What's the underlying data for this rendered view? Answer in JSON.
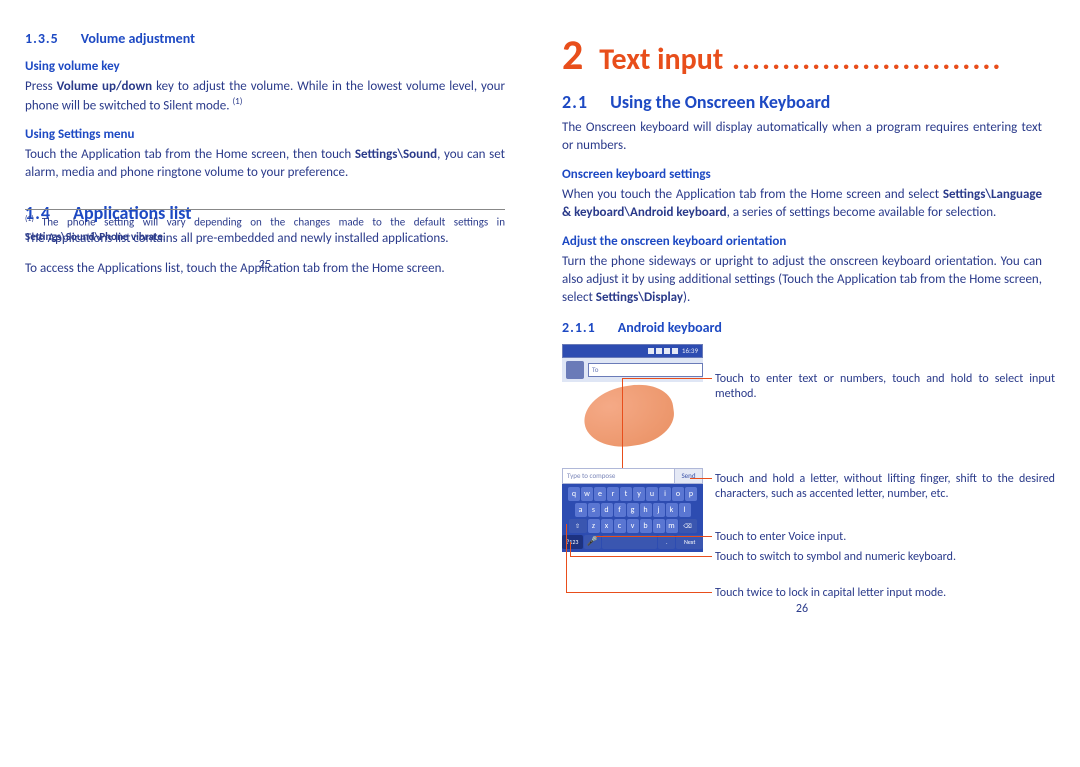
{
  "left": {
    "sec135_num": "1.3.5",
    "sec135_title": "Volume adjustment",
    "using_volume_key": "Using volume key",
    "volume_key_text_a": "Press ",
    "volume_key_bold": "Volume up/down",
    "volume_key_text_b": " key to adjust the volume. While in the lowest volume level, your phone will be switched to Silent mode. ",
    "volume_key_sup": "(1)",
    "using_settings_menu": "Using Settings menu",
    "settings_menu_a": "Touch the Application tab from the Home screen, then touch ",
    "settings_menu_bold": "Settings\\Sound",
    "settings_menu_b": ", you can set alarm, media and phone ringtone volume to your preference.",
    "sec14_num": "1.4",
    "sec14_title": "Applications list",
    "apps_p1": "The Applications list contains all pre-embedded and newly installed applications.",
    "apps_p2": "To access the Applications list, touch the Application tab from the Home screen.",
    "footnote_mark": "(1)",
    "footnote_a": "The phone setting will vary depending on the changes made to the default settings in ",
    "footnote_bold": "Settings\\Sound\\Phone vibrate",
    "footnote_b": ".",
    "page_num": "25"
  },
  "right": {
    "chapter_num": "2",
    "chapter_title": "Text input",
    "chapter_dots": " ...........................",
    "sec21_num": "2.1",
    "sec21_title": "Using the Onscreen Keyboard",
    "intro": "The Onscreen keyboard will display automatically when a program requires entering text or numbers.",
    "h_settings": "Onscreen keyboard settings",
    "settings_a": "When you touch the Application tab from the Home screen and select ",
    "settings_bold": "Settings\\Language & keyboard\\Android keyboard",
    "settings_b": ", a series of settings become available for selection.",
    "h_orient": "Adjust the onscreen keyboard orientation",
    "orient_a": "Turn the phone sideways or upright to adjust the onscreen keyboard orientation. You can also adjust it by using additional settings (Touch the Application tab from the Home screen, select ",
    "orient_bold": "Settings\\Display",
    "orient_b": ").",
    "sec211_num": "2.1.1",
    "sec211_title": "Android keyboard",
    "callout1": "Touch to enter text or numbers, touch and hold to select input method.",
    "callout2": "Touch and hold a letter, without lifting finger, shift to the desired characters, such as accented letter, number, etc.",
    "callout3": "Touch to enter Voice input.",
    "callout4": "Touch to switch to symbol and numeric keyboard.",
    "callout5": "Touch twice to lock in capital letter input mode.",
    "statusbar_time": "16:39",
    "to_label": "To",
    "compose_placeholder": "Type to compose",
    "send_label": "Send",
    "kb_row1": [
      "q",
      "w",
      "e",
      "r",
      "t",
      "y",
      "u",
      "i",
      "o",
      "p"
    ],
    "kb_row2": [
      "a",
      "s",
      "d",
      "f",
      "g",
      "h",
      "j",
      "k",
      "l"
    ],
    "kb_row3_shift": "⇧",
    "kb_row3": [
      "z",
      "x",
      "c",
      "v",
      "b",
      "n",
      "m"
    ],
    "kb_row3_del": "⌫",
    "kb_sym": "?123",
    "kb_mic": "🎤",
    "kb_next": "Next",
    "page_num": "26"
  }
}
